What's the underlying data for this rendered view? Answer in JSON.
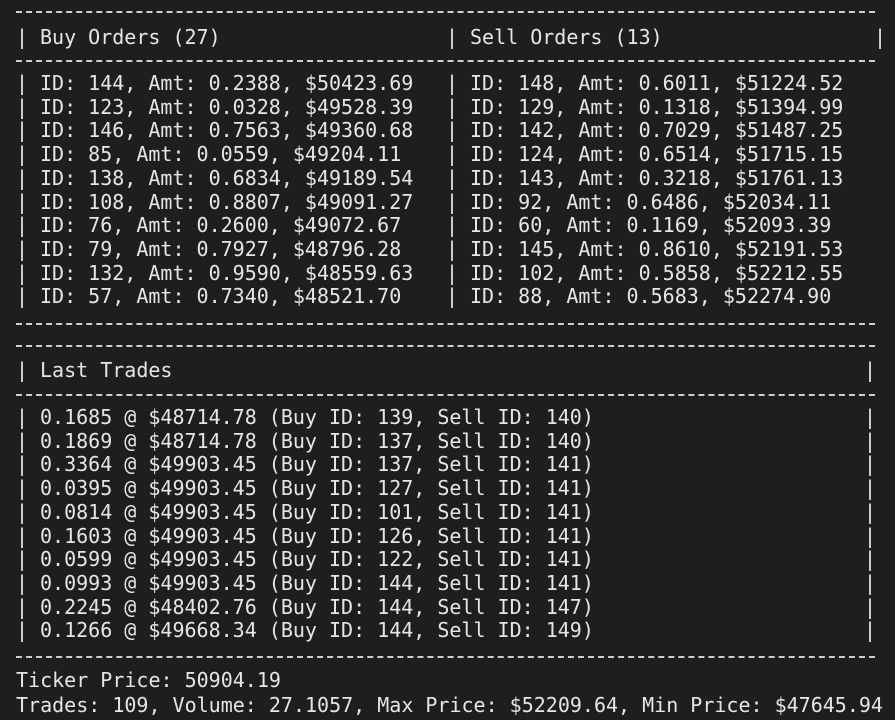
{
  "orders": {
    "buy_header": "Buy Orders (27)",
    "sell_header": "Sell Orders (13)",
    "buy": [
      "ID: 144, Amt: 0.2388, $50423.69",
      "ID: 123, Amt: 0.0328, $49528.39",
      "ID: 146, Amt: 0.7563, $49360.68",
      "ID: 85, Amt: 0.0559, $49204.11",
      "ID: 138, Amt: 0.6834, $49189.54",
      "ID: 108, Amt: 0.8807, $49091.27",
      "ID: 76, Amt: 0.2600, $49072.67",
      "ID: 79, Amt: 0.7927, $48796.28",
      "ID: 132, Amt: 0.9590, $48559.63",
      "ID: 57, Amt: 0.7340, $48521.70"
    ],
    "sell": [
      "ID: 148, Amt: 0.6011, $51224.52",
      "ID: 129, Amt: 0.1318, $51394.99",
      "ID: 142, Amt: 0.7029, $51487.25",
      "ID: 124, Amt: 0.6514, $51715.15",
      "ID: 143, Amt: 0.3218, $51761.13",
      "ID: 92, Amt: 0.6486, $52034.11",
      "ID: 60, Amt: 0.1169, $52093.39",
      "ID: 145, Amt: 0.8610, $52191.53",
      "ID: 102, Amt: 0.5858, $52212.55",
      "ID: 88, Amt: 0.5683, $52274.90"
    ]
  },
  "trades": {
    "header": "Last Trades",
    "rows": [
      "0.1685 @ $48714.78 (Buy ID: 139, Sell ID: 140)",
      "0.1869 @ $48714.78 (Buy ID: 137, Sell ID: 140)",
      "0.3364 @ $49903.45 (Buy ID: 137, Sell ID: 141)",
      "0.0395 @ $49903.45 (Buy ID: 127, Sell ID: 141)",
      "0.0814 @ $49903.45 (Buy ID: 101, Sell ID: 141)",
      "0.1603 @ $49903.45 (Buy ID: 126, Sell ID: 141)",
      "0.0599 @ $49903.45 (Buy ID: 122, Sell ID: 141)",
      "0.0993 @ $49903.45 (Buy ID: 144, Sell ID: 141)",
      "0.2245 @ $48402.76 (Buy ID: 144, Sell ID: 147)",
      "0.1266 @ $49668.34 (Buy ID: 144, Sell ID: 149)"
    ]
  },
  "footer": {
    "ticker": "Ticker Price: 50904.19",
    "stats": "Trades: 109, Volume: 27.1057, Max Price: $52209.64, Min Price: $47645.94"
  },
  "colors": {
    "background": "#1e1e1e",
    "text": "#e6e6e6"
  }
}
